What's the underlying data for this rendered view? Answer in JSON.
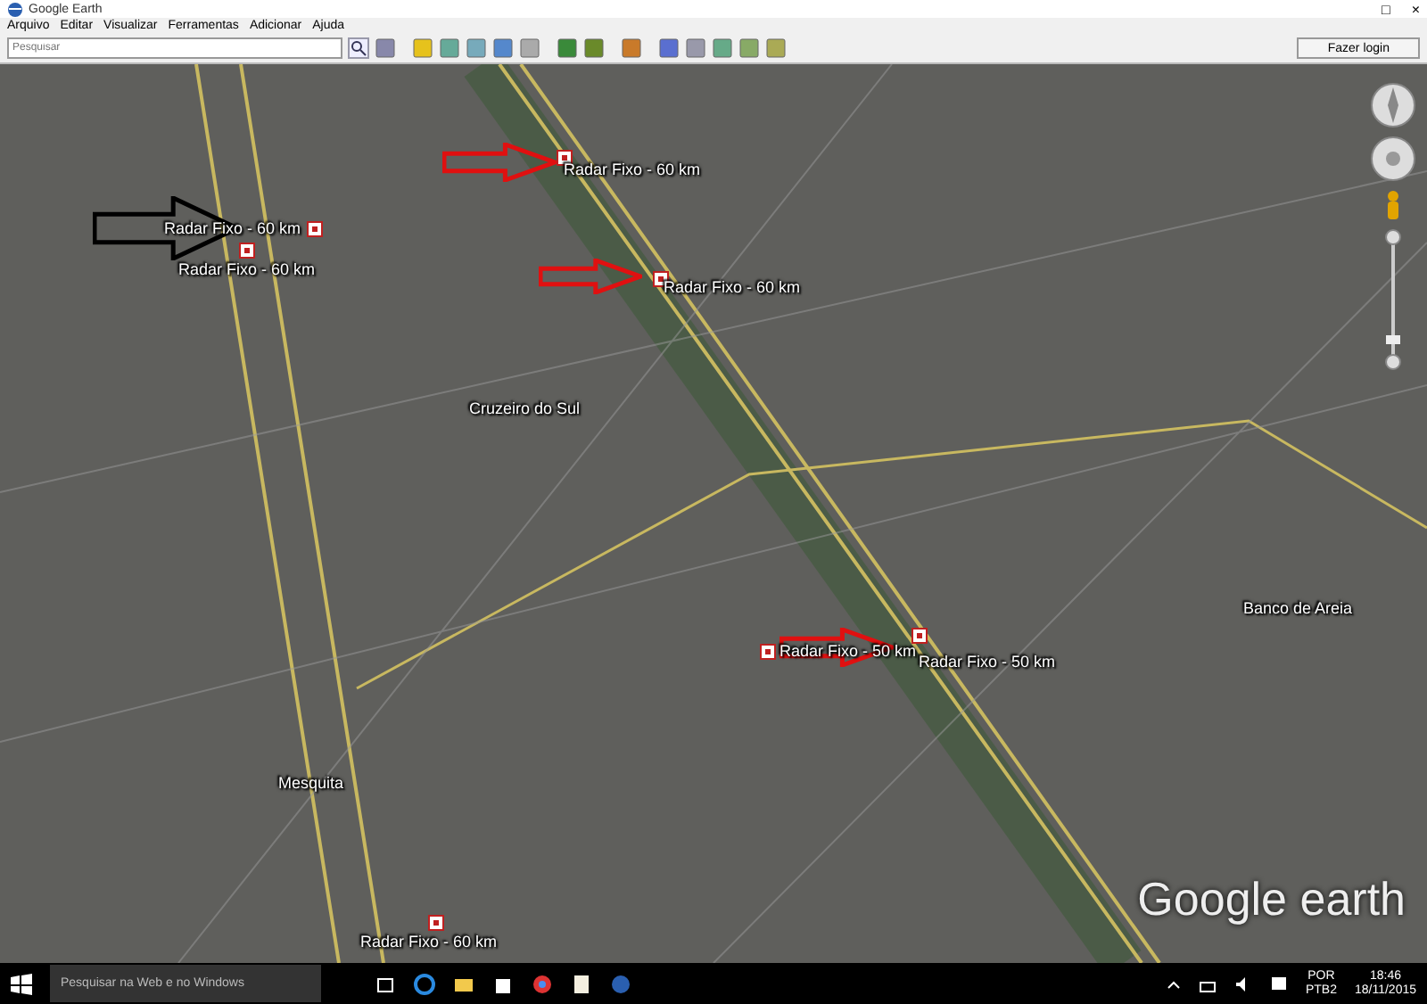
{
  "window": {
    "title": "Google Earth",
    "controls": [
      "□",
      "×"
    ]
  },
  "menu": [
    "Arquivo",
    "Editar",
    "Visualizar",
    "Ferramentas",
    "Adicionar",
    "Ajuda"
  ],
  "toolbar": {
    "search": {
      "placeholder": "Pesquisar"
    },
    "login_button": "Fazer login"
  },
  "map": {
    "placemarks": [
      {
        "label": "Radar Fixo - 60 km"
      },
      {
        "label": "Radar Fixo - 60 km"
      },
      {
        "label": "Radar Fixo - 60 km"
      },
      {
        "label": "Radar Fixo - 60 km"
      },
      {
        "label": "Radar Fixo - 50 km"
      },
      {
        "label": "Radar Fixo - 50 km"
      },
      {
        "label": "Radar Fixo - 60 km"
      }
    ],
    "places": [
      "Cruzeiro do Sul",
      "Banco de Areia",
      "Mesquita"
    ],
    "arrows": [
      {
        "color": "#000000"
      },
      {
        "color": "#e01010"
      },
      {
        "color": "#e01010"
      },
      {
        "color": "#e01010"
      }
    ],
    "logo": "Google earth"
  },
  "taskbar": {
    "search": {
      "placeholder": "Pesquisar na Web e no Windows"
    },
    "language": "POR",
    "layout": "PTB2",
    "time": "18:46",
    "date": "18/11/2015"
  }
}
